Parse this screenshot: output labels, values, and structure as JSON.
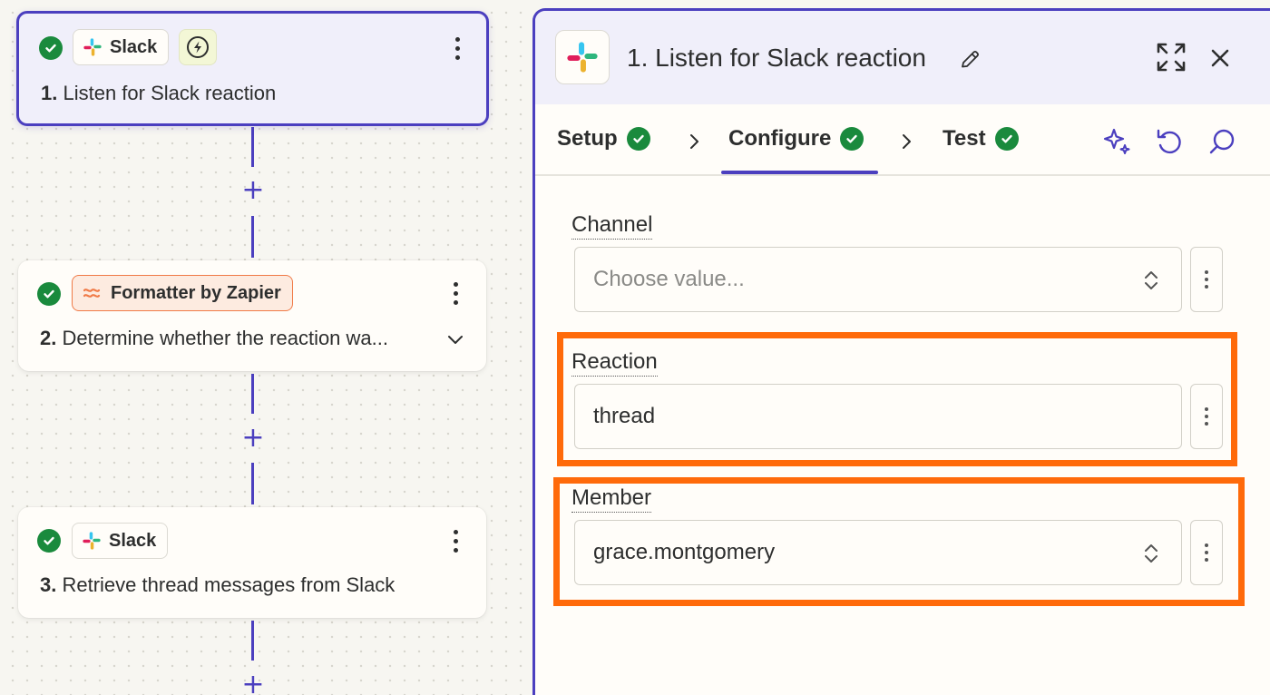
{
  "canvas": {
    "steps": [
      {
        "app": "Slack",
        "number": "1.",
        "title": "Listen for Slack reaction",
        "has_trigger_bolt": true
      },
      {
        "app": "Formatter by Zapier",
        "number": "2.",
        "title": "Determine whether the reaction wa...",
        "has_trigger_bolt": false
      },
      {
        "app": "Slack",
        "number": "3.",
        "title": "Retrieve thread messages from Slack",
        "has_trigger_bolt": false
      }
    ],
    "add_step_symbol": "+"
  },
  "panel": {
    "title": "1. Listen for Slack reaction",
    "tabs": [
      {
        "label": "Setup",
        "complete": true
      },
      {
        "label": "Configure",
        "complete": true,
        "active": true
      },
      {
        "label": "Test",
        "complete": true
      }
    ],
    "fields": [
      {
        "label": "Channel",
        "value": "",
        "placeholder": "Choose value...",
        "type": "dropdown",
        "highlighted": false
      },
      {
        "label": "Reaction",
        "value": "thread",
        "placeholder": "",
        "type": "text",
        "highlighted": true
      },
      {
        "label": "Member",
        "value": "grace.montgomery",
        "placeholder": "",
        "type": "dropdown",
        "highlighted": true
      }
    ]
  },
  "colors": {
    "accent": "#4b3fbf",
    "success": "#1a8a3d",
    "highlight": "#ff6a0a",
    "formatter": "#f07a47"
  }
}
